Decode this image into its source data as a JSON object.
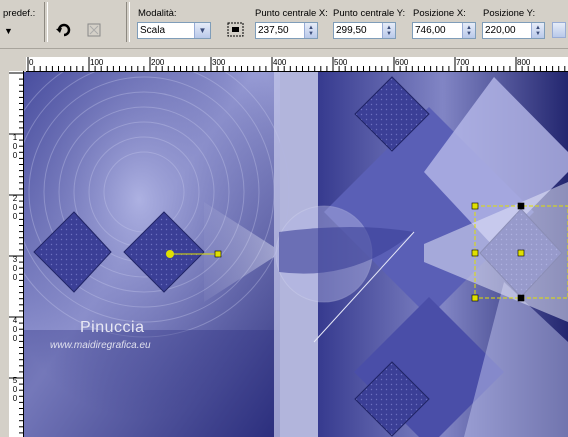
{
  "toolbar": {
    "preset_label": "predef.:",
    "mode_label": "Modalità:",
    "mode_value": "Scala",
    "center_x_label": "Punto centrale X:",
    "center_x_value": "237,50",
    "center_y_label": "Punto centrale Y:",
    "center_y_value": "299,50",
    "position_x_label": "Posizione X:",
    "position_x_value": "746,00",
    "position_y_label": "Posizione Y:",
    "position_y_value": "220,00"
  },
  "ruler_top": [
    "0",
    "100",
    "200",
    "300",
    "400",
    "500",
    "600",
    "700",
    "800"
  ],
  "ruler_left": [
    "1\n0\n0",
    "2\n0\n0",
    "3\n0\n0",
    "4\n0\n0",
    "5\n0\n0"
  ],
  "canvas": {
    "watermark": "Pinuccia",
    "watermark_url": "www.maidiregrafica.eu"
  },
  "colors": {
    "canvas_dark": "#2a2d7a",
    "canvas_light": "#b8bce8",
    "selection": "#e0e000"
  }
}
